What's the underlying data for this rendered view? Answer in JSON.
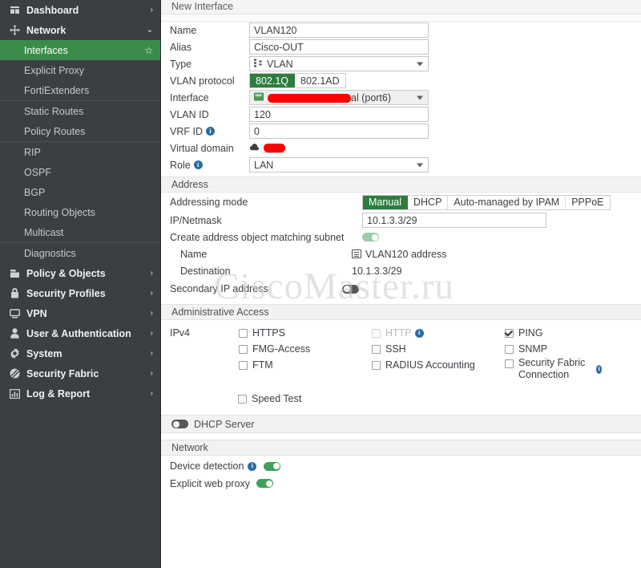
{
  "sidebar": {
    "items": [
      {
        "label": "Dashboard",
        "icon": "dashboard-icon",
        "level": "parent",
        "chevron": "›",
        "selected": false,
        "separator_after": false
      },
      {
        "label": "Network",
        "icon": "network-move-icon",
        "level": "parent",
        "chevron": "⌄",
        "selected": false,
        "separator_after": false
      },
      {
        "label": "Interfaces",
        "icon": "",
        "level": "sub",
        "chevron": "",
        "selected": true,
        "star": "☆",
        "separator_after": false
      },
      {
        "label": "Explicit Proxy",
        "icon": "",
        "level": "sub",
        "chevron": "",
        "selected": false,
        "separator_after": false
      },
      {
        "label": "FortiExtenders",
        "icon": "",
        "level": "sub",
        "chevron": "",
        "selected": false,
        "separator_after": true
      },
      {
        "label": "Static Routes",
        "icon": "",
        "level": "sub",
        "chevron": "",
        "selected": false,
        "separator_after": false
      },
      {
        "label": "Policy Routes",
        "icon": "",
        "level": "sub",
        "chevron": "",
        "selected": false,
        "separator_after": true
      },
      {
        "label": "RIP",
        "icon": "",
        "level": "sub",
        "chevron": "",
        "selected": false,
        "separator_after": false
      },
      {
        "label": "OSPF",
        "icon": "",
        "level": "sub",
        "chevron": "",
        "selected": false,
        "separator_after": false
      },
      {
        "label": "BGP",
        "icon": "",
        "level": "sub",
        "chevron": "",
        "selected": false,
        "separator_after": false
      },
      {
        "label": "Routing Objects",
        "icon": "",
        "level": "sub",
        "chevron": "",
        "selected": false,
        "separator_after": false
      },
      {
        "label": "Multicast",
        "icon": "",
        "level": "sub",
        "chevron": "",
        "selected": false,
        "separator_after": true
      },
      {
        "label": "Diagnostics",
        "icon": "",
        "level": "sub",
        "chevron": "",
        "selected": false,
        "separator_after": false
      },
      {
        "label": "Policy & Objects",
        "icon": "policy-objects-icon",
        "level": "parent",
        "chevron": "›",
        "selected": false,
        "separator_after": false
      },
      {
        "label": "Security Profiles",
        "icon": "lock-icon",
        "level": "parent",
        "chevron": "›",
        "selected": false,
        "separator_after": false
      },
      {
        "label": "VPN",
        "icon": "monitor-icon",
        "level": "parent",
        "chevron": "›",
        "selected": false,
        "separator_after": false
      },
      {
        "label": "User & Authentication",
        "icon": "user-icon",
        "level": "parent",
        "chevron": "›",
        "selected": false,
        "separator_after": false
      },
      {
        "label": "System",
        "icon": "gear-icon",
        "level": "parent",
        "chevron": "›",
        "selected": false,
        "separator_after": false
      },
      {
        "label": "Security Fabric",
        "icon": "security-fabric-icon",
        "level": "parent",
        "chevron": "›",
        "selected": false,
        "separator_after": false
      },
      {
        "label": "Log & Report",
        "icon": "chart-bar-icon",
        "level": "parent",
        "chevron": "›",
        "selected": false,
        "separator_after": false
      }
    ]
  },
  "header": {
    "title": "New Interface"
  },
  "form": {
    "name": {
      "label": "Name",
      "value": "VLAN120"
    },
    "alias": {
      "label": "Alias",
      "value": "Cisco-OUT"
    },
    "type": {
      "label": "Type",
      "value": "VLAN",
      "icon": "vlan-icon"
    },
    "vlan_protocol": {
      "label": "VLAN protocol",
      "options": [
        "802.1Q",
        "802.1AD"
      ],
      "selected": "802.1Q"
    },
    "interface": {
      "label": "Interface",
      "icon": "physical-port-icon",
      "value_suffix": "al (port6)",
      "redacted": true,
      "disabled": true
    },
    "vlan_id": {
      "label": "VLAN ID",
      "value": "120"
    },
    "vrf_id": {
      "label": "VRF ID",
      "value": "0",
      "info": "i"
    },
    "virtual_domain": {
      "label": "Virtual domain",
      "icon": "cloud-vdom-icon",
      "redacted": true
    },
    "role": {
      "label": "Role",
      "value": "LAN",
      "info": "i"
    }
  },
  "address": {
    "section_title": "Address",
    "addressing_mode": {
      "label": "Addressing mode",
      "options": [
        "Manual",
        "DHCP",
        "Auto-managed by IPAM",
        "PPPoE"
      ],
      "selected": "Manual"
    },
    "ip_netmask": {
      "label": "IP/Netmask",
      "value": "10.1.3.3/29"
    },
    "create_address_object": {
      "label": "Create address object matching subnet",
      "enabled": true
    },
    "object_name": {
      "label": "Name",
      "value": "VLAN120 address",
      "icon": "address-object-icon"
    },
    "object_destination": {
      "label": "Destination",
      "value": "10.1.3.3/29"
    },
    "secondary_ip": {
      "label": "Secondary IP address",
      "enabled": false
    }
  },
  "admin_access": {
    "section_title": "Administrative Access",
    "row_label": "IPv4",
    "columns": [
      [
        {
          "label": "HTTPS",
          "checked": false,
          "disabled": false,
          "info": false
        },
        {
          "label": "FMG-Access",
          "checked": false,
          "disabled": false,
          "info": false
        },
        {
          "label": "FTM",
          "checked": false,
          "disabled": false,
          "info": false
        }
      ],
      [
        {
          "label": "HTTP",
          "checked": false,
          "disabled": true,
          "info": true
        },
        {
          "label": "SSH",
          "checked": false,
          "disabled": false,
          "info": false
        },
        {
          "label": "RADIUS Accounting",
          "checked": false,
          "disabled": false,
          "info": false
        }
      ],
      [
        {
          "label": "PING",
          "checked": true,
          "disabled": false,
          "info": false
        },
        {
          "label": "SNMP",
          "checked": false,
          "disabled": false,
          "info": false
        },
        {
          "label": "Security Fabric Connection",
          "checked": false,
          "disabled": false,
          "info": true
        }
      ]
    ],
    "speed_test": {
      "label": "Speed Test",
      "checked": false
    }
  },
  "dhcp_server": {
    "label": "DHCP Server",
    "enabled": false
  },
  "network_section": {
    "section_title": "Network",
    "device_detection": {
      "label": "Device detection",
      "enabled": true,
      "info": "i"
    },
    "explicit_web_proxy": {
      "label": "Explicit web proxy",
      "enabled": true
    }
  },
  "watermark": {
    "text": "CiscoMaster.ru"
  },
  "colors": {
    "accent_green": "#2f7d3e",
    "sidebar_bg": "#3b3f42",
    "selected_green": "#3c8c49",
    "toggle_on": "#3fa05a",
    "redaction_red": "#ff0000",
    "info_blue": "#2b6ca3"
  }
}
